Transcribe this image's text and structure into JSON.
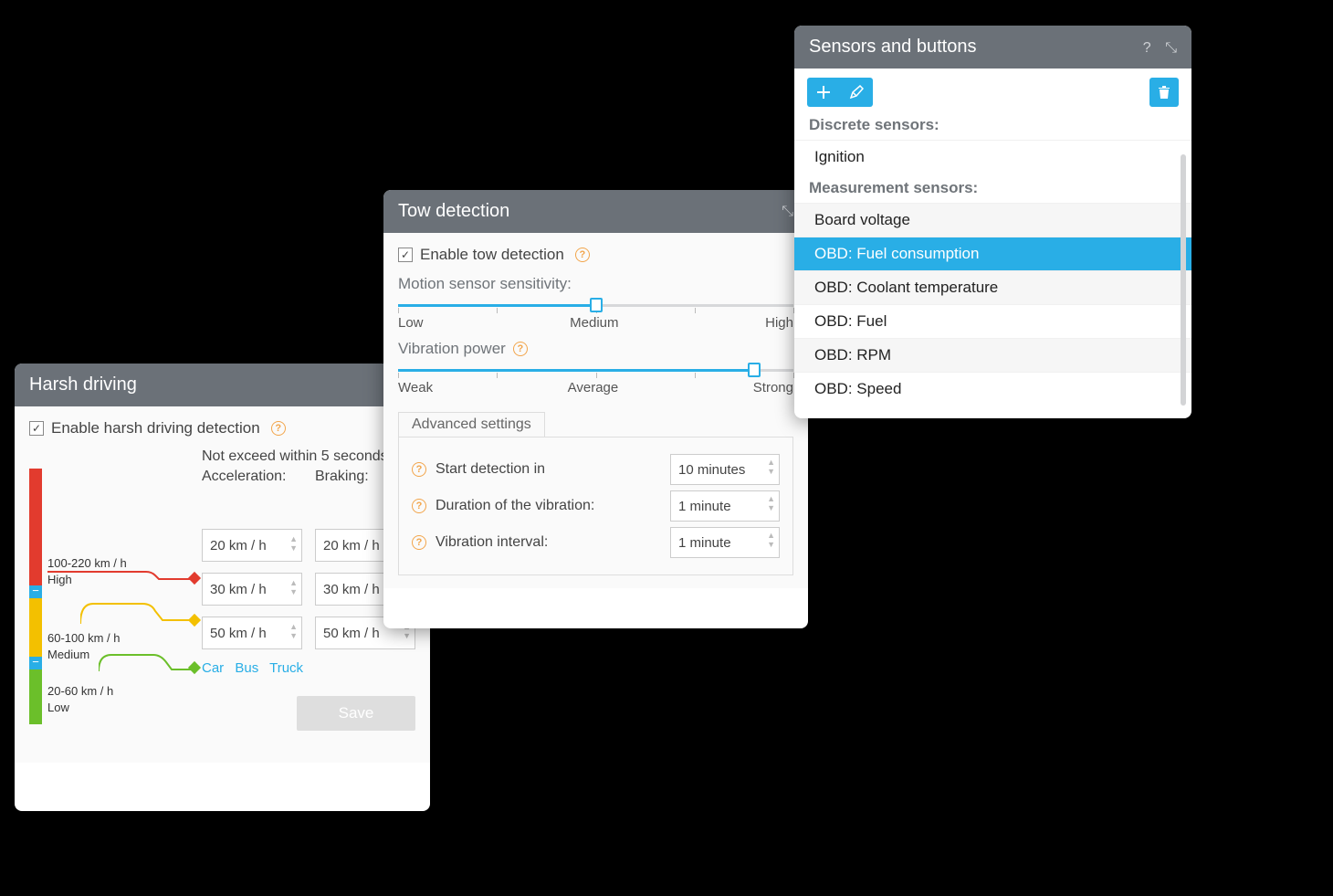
{
  "sensors": {
    "title": "Sensors and buttons",
    "group_discrete": "Discrete sensors:",
    "group_measurement": "Measurement sensors:",
    "items_discrete": [
      "Ignition"
    ],
    "items_measurement": [
      "Board voltage",
      "OBD: Fuel consumption",
      "OBD: Coolant temperature",
      "OBD: Fuel",
      "OBD: RPM",
      "OBD: Speed"
    ]
  },
  "tow": {
    "title": "Tow detection",
    "enable_label": "Enable tow detection",
    "motion_label": "Motion sensor sensitivity:",
    "motion_scale": {
      "low": "Low",
      "mid": "Medium",
      "high": "High"
    },
    "vibration_label": "Vibration power",
    "vibration_scale": {
      "low": "Weak",
      "mid": "Average",
      "high": "Strong"
    },
    "advanced_title": "Advanced settings",
    "start_label": "Start detection in",
    "start_value": "10  minutes",
    "duration_label": "Duration of the vibration:",
    "duration_value": "1  minute",
    "interval_label": "Vibration interval:",
    "interval_value": "1  minute"
  },
  "harsh": {
    "title": "Harsh driving",
    "enable_label": "Enable harsh driving detection",
    "hint": "Not exceed within 5 seconds:",
    "col_accel": "Acceleration:",
    "col_brake": "Braking:",
    "range_high": "100-220 km / h",
    "level_high": "High",
    "range_med": "60-100 km / h",
    "level_med": "Medium",
    "range_low": "20-60 km / h",
    "level_low": "Low",
    "high_accel": "20  km / h",
    "high_brake": "20  km / h",
    "med_accel": "30  km / h",
    "med_brake": "30  km / h",
    "low_accel": "50  km / h",
    "low_brake": "50  km / h",
    "preset_car": "Car",
    "preset_bus": "Bus",
    "preset_truck": "Truck",
    "save": "Save"
  }
}
